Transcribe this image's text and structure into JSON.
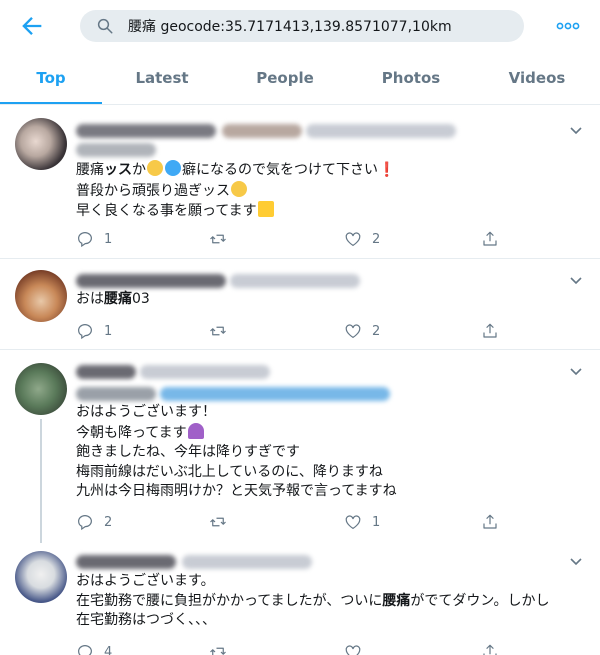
{
  "header": {
    "search_value": "腰痛 geocode:35.7171413,139.8571077,10km"
  },
  "tabs": [
    {
      "label": "Top",
      "active": true
    },
    {
      "label": "Latest",
      "active": false
    },
    {
      "label": "People",
      "active": false
    },
    {
      "label": "Photos",
      "active": false
    },
    {
      "label": "Videos",
      "active": false
    }
  ],
  "colors": {
    "accent": "#1da1f2",
    "muted": "#657786",
    "divider": "#e6ecf0",
    "search_bg": "#e6ecf0"
  },
  "icons": {
    "back": "arrow-left-icon",
    "search": "search-icon",
    "more": "more-dots-icon",
    "chevron": "chevron-down-icon",
    "reply": "reply-icon",
    "retweet": "retweet-icon",
    "like": "heart-icon",
    "share": "share-icon"
  },
  "tweets": [
    {
      "lines": [
        {
          "pre": "腰痛",
          "bold": "ッス",
          "post": "か"
        },
        {
          "pre": "普段から頑張り過ぎッス",
          "bold": "",
          "post": ""
        },
        {
          "pre": "早く良くなる事を願ってます",
          "bold": "",
          "post": ""
        }
      ],
      "line1_tail": "癖になるので気をつけて下さい❗",
      "replies": "1",
      "retweets": "",
      "likes": "2"
    },
    {
      "lines": [
        {
          "pre": "おは",
          "bold": "腰痛",
          "post": "03"
        }
      ],
      "replies": "1",
      "retweets": "",
      "likes": "2"
    },
    {
      "lines": [
        {
          "pre": "おはようございます！",
          "bold": "",
          "post": ""
        },
        {
          "pre": "今朝も降ってます",
          "bold": "",
          "post": ""
        },
        {
          "pre": "飽きましたね、今年は降りすぎです",
          "bold": "",
          "post": ""
        },
        {
          "pre": "梅雨前線はだいぶ北上しているのに、降りますね",
          "bold": "",
          "post": ""
        },
        {
          "pre": "九州は今日梅雨明けか？と天気予報で言ってますね",
          "bold": "",
          "post": ""
        }
      ],
      "replies": "2",
      "retweets": "",
      "likes": "1"
    },
    {
      "lines": [
        {
          "pre": "おはようございます。",
          "bold": "",
          "post": ""
        },
        {
          "pre": "在宅勤務で腰に負担がかかってましたが、ついに",
          "bold": "腰痛",
          "post": "がでてダウン。しかし"
        },
        {
          "pre": "在宅勤務はつづく、、、",
          "bold": "",
          "post": ""
        }
      ],
      "replies": "4",
      "retweets": "",
      "likes": ""
    }
  ]
}
